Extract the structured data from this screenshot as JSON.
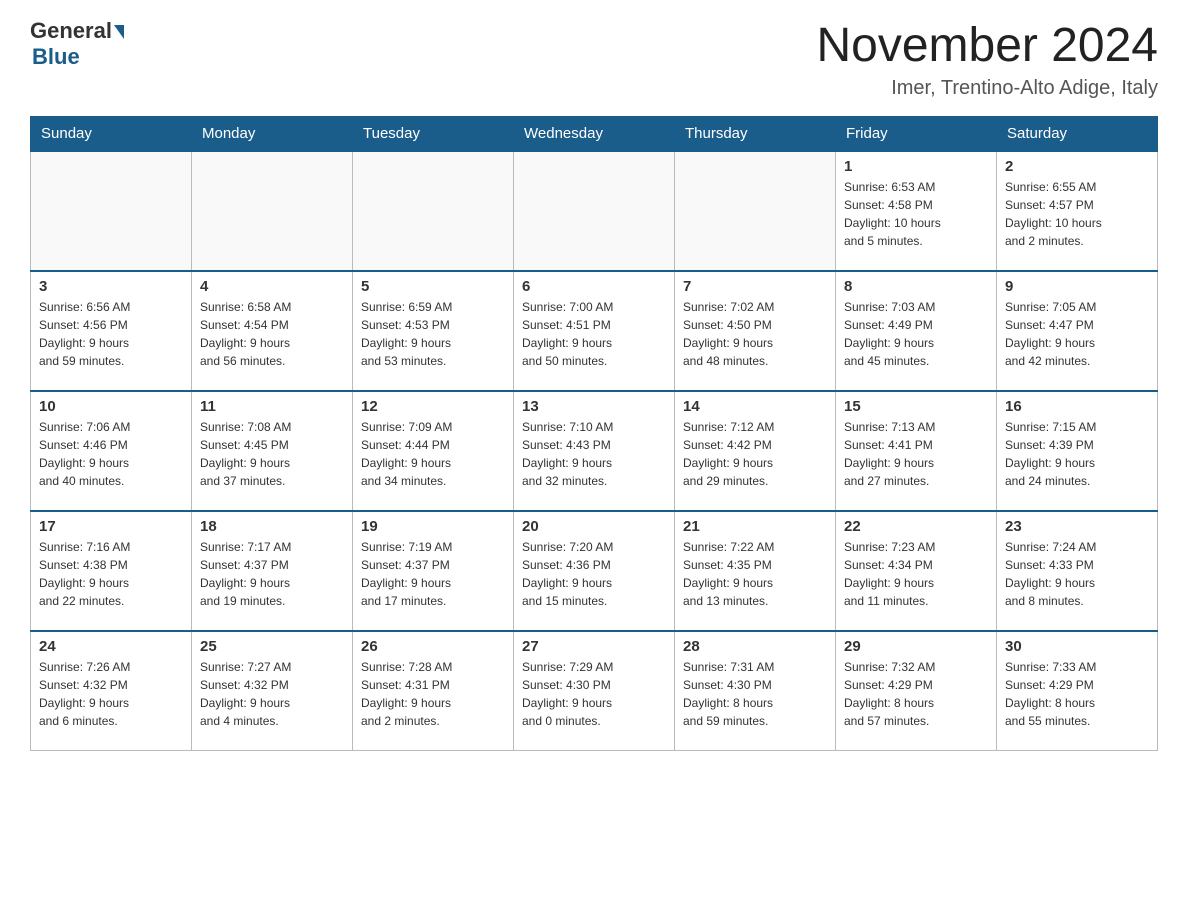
{
  "header": {
    "logo_text_general": "General",
    "logo_text_blue": "Blue",
    "month_title": "November 2024",
    "location": "Imer, Trentino-Alto Adige, Italy"
  },
  "weekdays": [
    "Sunday",
    "Monday",
    "Tuesday",
    "Wednesday",
    "Thursday",
    "Friday",
    "Saturday"
  ],
  "weeks": [
    [
      {
        "day": "",
        "info": ""
      },
      {
        "day": "",
        "info": ""
      },
      {
        "day": "",
        "info": ""
      },
      {
        "day": "",
        "info": ""
      },
      {
        "day": "",
        "info": ""
      },
      {
        "day": "1",
        "info": "Sunrise: 6:53 AM\nSunset: 4:58 PM\nDaylight: 10 hours\nand 5 minutes."
      },
      {
        "day": "2",
        "info": "Sunrise: 6:55 AM\nSunset: 4:57 PM\nDaylight: 10 hours\nand 2 minutes."
      }
    ],
    [
      {
        "day": "3",
        "info": "Sunrise: 6:56 AM\nSunset: 4:56 PM\nDaylight: 9 hours\nand 59 minutes."
      },
      {
        "day": "4",
        "info": "Sunrise: 6:58 AM\nSunset: 4:54 PM\nDaylight: 9 hours\nand 56 minutes."
      },
      {
        "day": "5",
        "info": "Sunrise: 6:59 AM\nSunset: 4:53 PM\nDaylight: 9 hours\nand 53 minutes."
      },
      {
        "day": "6",
        "info": "Sunrise: 7:00 AM\nSunset: 4:51 PM\nDaylight: 9 hours\nand 50 minutes."
      },
      {
        "day": "7",
        "info": "Sunrise: 7:02 AM\nSunset: 4:50 PM\nDaylight: 9 hours\nand 48 minutes."
      },
      {
        "day": "8",
        "info": "Sunrise: 7:03 AM\nSunset: 4:49 PM\nDaylight: 9 hours\nand 45 minutes."
      },
      {
        "day": "9",
        "info": "Sunrise: 7:05 AM\nSunset: 4:47 PM\nDaylight: 9 hours\nand 42 minutes."
      }
    ],
    [
      {
        "day": "10",
        "info": "Sunrise: 7:06 AM\nSunset: 4:46 PM\nDaylight: 9 hours\nand 40 minutes."
      },
      {
        "day": "11",
        "info": "Sunrise: 7:08 AM\nSunset: 4:45 PM\nDaylight: 9 hours\nand 37 minutes."
      },
      {
        "day": "12",
        "info": "Sunrise: 7:09 AM\nSunset: 4:44 PM\nDaylight: 9 hours\nand 34 minutes."
      },
      {
        "day": "13",
        "info": "Sunrise: 7:10 AM\nSunset: 4:43 PM\nDaylight: 9 hours\nand 32 minutes."
      },
      {
        "day": "14",
        "info": "Sunrise: 7:12 AM\nSunset: 4:42 PM\nDaylight: 9 hours\nand 29 minutes."
      },
      {
        "day": "15",
        "info": "Sunrise: 7:13 AM\nSunset: 4:41 PM\nDaylight: 9 hours\nand 27 minutes."
      },
      {
        "day": "16",
        "info": "Sunrise: 7:15 AM\nSunset: 4:39 PM\nDaylight: 9 hours\nand 24 minutes."
      }
    ],
    [
      {
        "day": "17",
        "info": "Sunrise: 7:16 AM\nSunset: 4:38 PM\nDaylight: 9 hours\nand 22 minutes."
      },
      {
        "day": "18",
        "info": "Sunrise: 7:17 AM\nSunset: 4:37 PM\nDaylight: 9 hours\nand 19 minutes."
      },
      {
        "day": "19",
        "info": "Sunrise: 7:19 AM\nSunset: 4:37 PM\nDaylight: 9 hours\nand 17 minutes."
      },
      {
        "day": "20",
        "info": "Sunrise: 7:20 AM\nSunset: 4:36 PM\nDaylight: 9 hours\nand 15 minutes."
      },
      {
        "day": "21",
        "info": "Sunrise: 7:22 AM\nSunset: 4:35 PM\nDaylight: 9 hours\nand 13 minutes."
      },
      {
        "day": "22",
        "info": "Sunrise: 7:23 AM\nSunset: 4:34 PM\nDaylight: 9 hours\nand 11 minutes."
      },
      {
        "day": "23",
        "info": "Sunrise: 7:24 AM\nSunset: 4:33 PM\nDaylight: 9 hours\nand 8 minutes."
      }
    ],
    [
      {
        "day": "24",
        "info": "Sunrise: 7:26 AM\nSunset: 4:32 PM\nDaylight: 9 hours\nand 6 minutes."
      },
      {
        "day": "25",
        "info": "Sunrise: 7:27 AM\nSunset: 4:32 PM\nDaylight: 9 hours\nand 4 minutes."
      },
      {
        "day": "26",
        "info": "Sunrise: 7:28 AM\nSunset: 4:31 PM\nDaylight: 9 hours\nand 2 minutes."
      },
      {
        "day": "27",
        "info": "Sunrise: 7:29 AM\nSunset: 4:30 PM\nDaylight: 9 hours\nand 0 minutes."
      },
      {
        "day": "28",
        "info": "Sunrise: 7:31 AM\nSunset: 4:30 PM\nDaylight: 8 hours\nand 59 minutes."
      },
      {
        "day": "29",
        "info": "Sunrise: 7:32 AM\nSunset: 4:29 PM\nDaylight: 8 hours\nand 57 minutes."
      },
      {
        "day": "30",
        "info": "Sunrise: 7:33 AM\nSunset: 4:29 PM\nDaylight: 8 hours\nand 55 minutes."
      }
    ]
  ]
}
